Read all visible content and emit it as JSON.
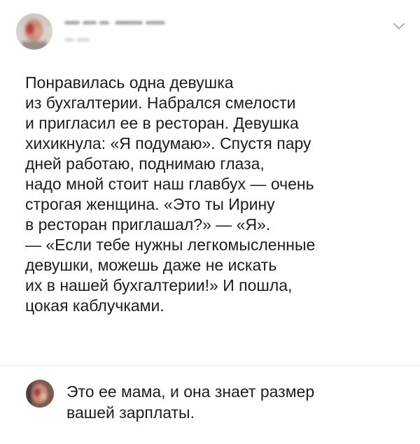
{
  "post": {
    "avatar_icon": "user-avatar-blurred",
    "author_blurred": true,
    "menu_icon": "chevron-down-icon",
    "text": "Понравилась одна девушка\nиз бухгалтерии. Набрался смелости\nи пригласил ее в ресторан. Девушка\nхихикнула: «Я подумаю». Спустя пару\nдней работаю, поднимаю глаза,\nнадо мной стоит наш главбух — очень\nстрогая женщина. «Это ты Ирину\nв ресторан приглашал?» — «Я».\n— «Если тебе нужны легкомысленные\nдевушки, можешь даже не искать\nих в нашей бухгалтерии!» И пошла,\nцокая каблучками."
  },
  "comment": {
    "avatar_icon": "user-avatar-blurred",
    "text": "Это ее мама, и она знает размер\nвашей зарплаты."
  },
  "colors": {
    "text": "#1d1d1d",
    "divider": "#ebebeb",
    "chevron": "#9aa3ab"
  }
}
